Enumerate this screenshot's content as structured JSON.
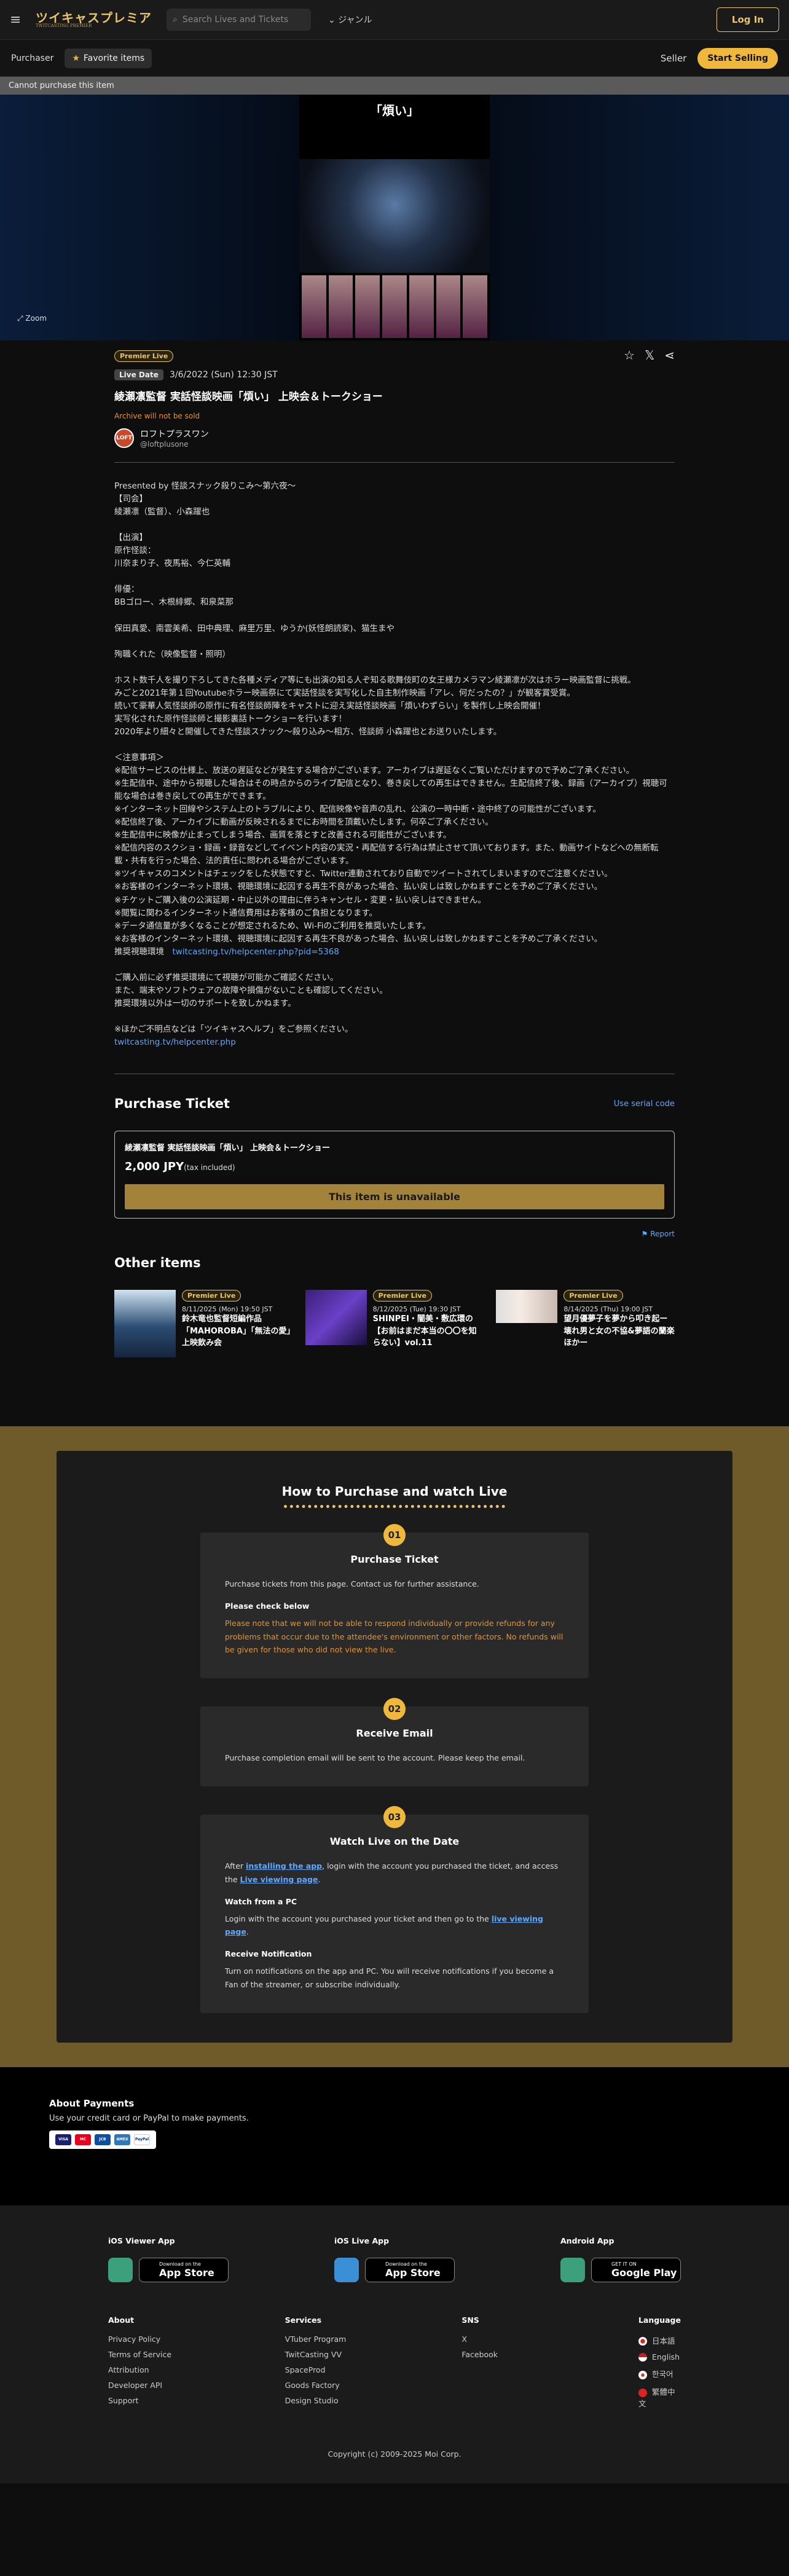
{
  "header": {
    "logo": "ツイキャスプレミア",
    "logo_sub": "TWITCASTING PREMIER",
    "search_placeholder": "Search Lives and Tickets",
    "genre": "ジャンル",
    "login": "Log In"
  },
  "subbar": {
    "purchaser": "Purchaser",
    "favorite": "Favorite items",
    "seller": "Seller",
    "start_selling": "Start Selling"
  },
  "notice": "Cannot purchase this item",
  "hero": {
    "zoom": "Zoom",
    "poster_title": "「煩い」"
  },
  "event": {
    "premier": "Premier Live",
    "date_badge": "Live Date",
    "date": "3/6/2022 (Sun) 12:30 JST",
    "title": "綾瀬凛監督 実話怪談映画「煩い」 上映会＆トークショー",
    "archive": "Archive will not be sold",
    "seller_name": "ロフトプラスワン",
    "seller_handle": "@loftplusone",
    "avatar_text": "LOFT",
    "description": "Presented by 怪談スナック殺りこみ〜第六夜〜\n【司会】\n綾瀬凛（監督）、小森躍也\n\n【出演】\n原作怪談：\n川奈まり子、夜馬裕、今仁英輔\n\n俳優：\nBBゴロー、木根緋郷、和泉菜那\n\n保田真愛、南雲美希、田中典理、麻里万里、ゆうか(妖怪朗読家)、猫生まや\n\n殉職くれた（映像監督・照明）\n\nホスト数千人を撮り下ろしてきた各種メディア等にも出演の知る人ぞ知る歌舞伎町の女王様カメラマン綾瀬凛が次はホラー映画監督に挑戦。\nみごと2021年第１回Youtubeホラー映画祭にて実話怪談を実写化した自主制作映画「アレ、何だったの？」が観客賞受賞。\n続いて豪華人気怪談師の原作に有名怪談師陣をキャストに迎え実話怪談映画「煩いわずらい」を製作し上映会開催！\n実写化された原作怪談師と撮影裏話トークショーを行います！\n2020年より細々と開催してきた怪談スナック〜殺り込み〜相方、怪談師 小森躍也とお送りいたします。\n\n＜注意事項＞\n※配信サービスの仕様上、放送の遅延などが発生する場合がございます。アーカイブは遅延なくご覧いただけますので予めご了承ください。\n※生配信中、途中から視聴した場合はその時点からのライブ配信となり、巻き戻しての再生はできません。生配信終了後、録画（アーカイブ）視聴可能な場合は巻き戻しての再生ができます。\n※インターネット回線やシステム上のトラブルにより、配信映像や音声の乱れ、公演の一時中断・途中終了の可能性がございます。\n※配信終了後、アーカイブに動画が反映されるまでにお時間を頂戴いたします。何卒ご了承ください。\n※生配信中に映像が止まってしまう場合、画質を落とすと改善される可能性がございます。\n※配信内容のスクショ・録画・録音などしてイベント内容の実況・再配信する行為は禁止させて頂いております。また、動画サイトなどへの無断転載・共有を行った場合、法的責任に問われる場合がございます。\n※ツイキャスのコメントはチェックをした状態ですと、Twitter連動されており自動でツイートされてしまいますのでご注意ください。\n※お客様のインターネット環境、視聴環境に起因する再生不良があった場合、払い戻しは致しかねますことを予めご了承ください。\n※チケットご購入後の公演延期・中止以外の理由に伴うキャンセル・変更・払い戻しはできません。\n※閲覧に関わるインターネット通信費用はお客様のご負担となります。\n※データ通信量が多くなることが想定されるため、Wi-Fiのご利用を推奨いたします。\n※お客様のインターネット環境、視聴環境に起因する再生不良があった場合、払い戻しは致しかねますことを予めご了承ください。",
    "env_label": "推奨視聴環境",
    "env_link": "twitcasting.tv/helpcenter.php?pid=5368",
    "desc2": "\nご購入前に必ず推奨環境にて視聴が可能かご確認ください。\nまた、端末やソフトウェアの故障や損傷がないことも確認してください。\n推奨環境以外は一切のサポートを致しかねます。\n\n※ほかご不明点などは「ツイキャスヘルプ」をご参照ください。",
    "help_link": "twitcasting.tv/helpcenter.php"
  },
  "purchase": {
    "heading": "Purchase Ticket",
    "serial": "Use serial code",
    "ticket_name": "綾瀬凛監督 実話怪談映画「煩い」 上映会＆トークショー",
    "price": "2,000 JPY",
    "tax": "(tax included)",
    "unavailable": "This item is unavailable",
    "report": "Report"
  },
  "other": {
    "heading": "Other items",
    "items": [
      {
        "badge": "Premier Live",
        "date": "8/11/2025 (Mon) 19:50 JST",
        "title": "鈴木竜也監督短編作品「MAHOROBA」「無法の愛」上映飲み会"
      },
      {
        "badge": "Premier Live",
        "date": "8/12/2025 (Tue) 19:30 JST",
        "title": "SHINPEI・闇美・敷広環の【お前はまだ本当の〇〇を知らない】vol.11"
      },
      {
        "badge": "Premier Live",
        "date": "8/14/2025 (Thu) 19:00 JST",
        "title": "望月優夢子を夢から叩き起ー壊れ男と女の不協&夢語の蘭楽ほかー"
      }
    ]
  },
  "how": {
    "heading": "How to Purchase and watch Live",
    "s1": {
      "num": "01",
      "title": "Purchase Ticket",
      "text": "Purchase tickets from this page. Contact us for further assistance.",
      "sub": "Please check below",
      "warn": "Please note that we will not be able to respond individually or provide refunds for any problems that occur due to the attendee's environment or other factors. No refunds will be given for those who did not view the live."
    },
    "s2": {
      "num": "02",
      "title": "Receive Email",
      "text": "Purchase completion email will be sent to the account. Please keep the email."
    },
    "s3": {
      "num": "03",
      "title": "Watch Live on the Date",
      "t1a": "After ",
      "t1link": "installing the app",
      "t1b": ", login with the account you purchased the ticket, and access the ",
      "t1link2": "Live viewing page",
      "t1c": ".",
      "h_pc": "Watch from a PC",
      "t2a": "Login with the account you purchased your ticket and then go to the ",
      "t2link": "live viewing page",
      "t2b": ".",
      "h_notif": "Receive Notification",
      "t3": "Turn on notifications on the app and PC. You will receive notifications if you become a Fan of the streamer, or subscribe individually."
    }
  },
  "payments": {
    "heading": "About Payments",
    "text": "Use your credit card or PayPal to make payments.",
    "cards": [
      "VISA",
      "MC",
      "JCB",
      "AMEX",
      "PayPal"
    ]
  },
  "footer": {
    "ios_viewer": "iOS Viewer App",
    "ios_live": "iOS Live App",
    "android": "Android App",
    "dl_on": "Download on the",
    "app_store": "App Store",
    "get_it": "GET IT ON",
    "google_play": "Google Play",
    "about": "About",
    "about_links": [
      "Privacy Policy",
      "Terms of Service",
      "Attribution",
      "Developer API",
      "Support"
    ],
    "services": "Services",
    "services_links": [
      "VTuber Program",
      "TwitCasting VV",
      "SpaceProd",
      "Goods Factory",
      "Design Studio"
    ],
    "sns": "SNS",
    "sns_links": [
      "X",
      "Facebook"
    ],
    "language": "Language",
    "languages": [
      "日本語",
      "English",
      "한국어",
      "繁體中文"
    ],
    "copyright": "Copyright (c) 2009-2025 Moi Corp."
  }
}
